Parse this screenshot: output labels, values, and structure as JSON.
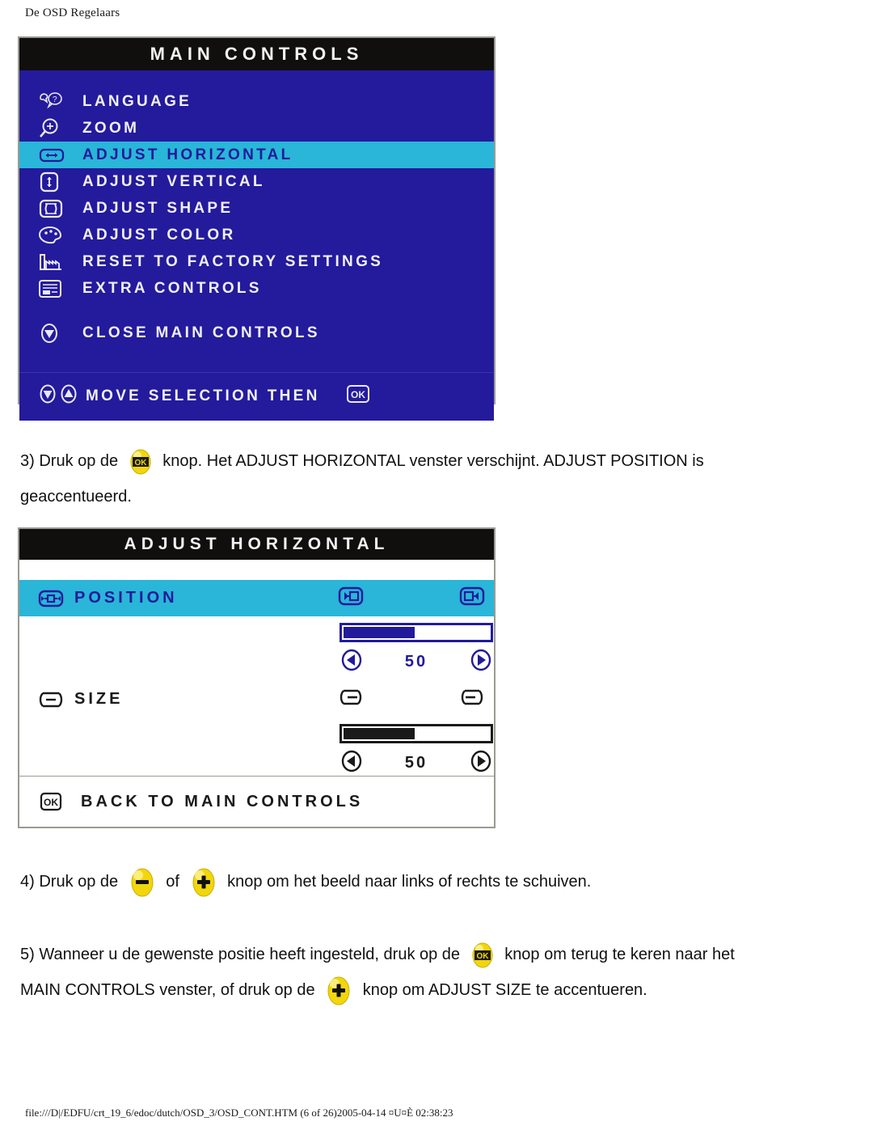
{
  "document": {
    "header_title": "De OSD Regelaars",
    "footer": "file:///D|/EDFU/crt_19_6/edoc/dutch/OSD_3/OSD_CONT.HTM (6 of 26)2005-04-14 ¤U¤È 02:38:23"
  },
  "colors": {
    "osd_blue_bg": "#241a9c",
    "osd_highlight_cyan": "#29b6d8",
    "osd_title_black": "#100f0d",
    "osd_text_white": "#f0f0f5",
    "osd_text_blue": "#221a9b",
    "button_yellow": "#f2d60c",
    "panel_border": "#9a9a92"
  },
  "main_controls": {
    "title": "MAIN CONTROLS",
    "items": [
      {
        "label": "LANGUAGE",
        "icon": "language-icon",
        "selected": false
      },
      {
        "label": "ZOOM",
        "icon": "zoom-magnifier-icon",
        "selected": false
      },
      {
        "label": "ADJUST HORIZONTAL",
        "icon": "adjust-horizontal-icon",
        "selected": true
      },
      {
        "label": "ADJUST VERTICAL",
        "icon": "adjust-vertical-icon",
        "selected": false
      },
      {
        "label": "ADJUST SHAPE",
        "icon": "adjust-shape-icon",
        "selected": false
      },
      {
        "label": "ADJUST COLOR",
        "icon": "color-palette-icon",
        "selected": false
      },
      {
        "label": "RESET TO FACTORY SETTINGS",
        "icon": "factory-reset-icon",
        "selected": false
      },
      {
        "label": "EXTRA CONTROLS",
        "icon": "extra-controls-icon",
        "selected": false
      }
    ],
    "close_item": {
      "label": "CLOSE MAIN CONTROLS",
      "icon": "close-down-arrow-icon"
    },
    "footer_hint": {
      "label": "MOVE SELECTION THEN",
      "icons": [
        "arrow-down-circle-icon",
        "arrow-up-circle-icon",
        "ok-box-icon"
      ]
    }
  },
  "adjust_horizontal": {
    "title": "ADJUST HORIZONTAL",
    "position_row": {
      "label": "POSITION",
      "icon": "position-icon",
      "left_icon": "move-left-icon",
      "right_icon": "move-right-icon",
      "selected": true,
      "value": "50",
      "fill_percent": 50,
      "dec_icon": "arrow-left-circle-icon",
      "inc_icon": "arrow-right-circle-icon"
    },
    "size_row": {
      "label": "SIZE",
      "icon": "size-icon",
      "left_icon": "size-shrink-icon",
      "right_icon": "size-grow-icon",
      "selected": false,
      "value": "50",
      "fill_percent": 50,
      "dec_icon": "arrow-left-circle-icon",
      "inc_icon": "arrow-right-circle-icon"
    },
    "back_item": {
      "label": "BACK TO MAIN CONTROLS",
      "icon": "ok-box-icon"
    }
  },
  "steps": {
    "step3": {
      "prefix": "3) Druk op de",
      "button": "ok-button",
      "line1_rest": "knop. Het ADJUST HORIZONTAL venster verschijnt. ADJUST POSITION is",
      "line2": "geaccentueerd."
    },
    "step4": {
      "prefix": "4) Druk op de",
      "button_minus": "minus-button",
      "middle": "of",
      "button_plus": "plus-button",
      "suffix": "knop om het beeld naar links of rechts te schuiven."
    },
    "step5": {
      "line1_prefix": "5) Wanneer u de gewenste positie heeft ingesteld, druk op de",
      "button_ok": "ok-button",
      "line1_suffix": "knop om terug te keren naar het",
      "line2_prefix": "MAIN CONTROLS venster, of druk op de",
      "button_plus": "plus-button",
      "line2_suffix": "knop om ADJUST SIZE te accentueren."
    }
  }
}
